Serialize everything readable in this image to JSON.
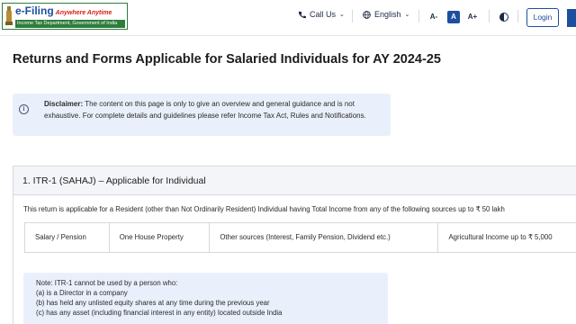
{
  "header": {
    "logo": {
      "title": "e-Filing",
      "tagline": "Anywhere Anytime",
      "subtitle": "Income Tax Department, Government of India"
    },
    "call_us": "Call Us",
    "language": "English",
    "font_small": "A-",
    "font_normal": "A",
    "font_large": "A+",
    "login": "Login"
  },
  "page_title": "Returns and Forms Applicable for Salaried Individuals for AY 2024-25",
  "disclaimer": {
    "label": "Disclaimer:",
    "text": " The content on this page is only to give an overview and general guidance and is not exhaustive. For complete details and guidelines please refer Income Tax Act, Rules and Notifications."
  },
  "itr1": {
    "title": "1. ITR-1 (SAHAJ) – Applicable for Individual",
    "description": "This return is applicable for a Resident (other than Not Ordinarily Resident) Individual having Total Income from any of the following sources up to ₹ 50 lakh",
    "sources": [
      "Salary / Pension",
      "One House Property",
      "Other sources (Interest, Family Pension, Dividend etc.)",
      "Agricultural Income up to ₹ 5,000"
    ],
    "note": [
      "Note: ITR-1 cannot be used by a person who:",
      "(a) is a Director in a company",
      "(b) has held any unlisted equity shares at any time during the previous year",
      "(c) has any asset (including financial interest in any entity) located outside India"
    ]
  },
  "colors": {
    "brand_blue": "#1c4fa0",
    "brand_green": "#2f7c3c",
    "info_bg": "#eaf0fb"
  }
}
